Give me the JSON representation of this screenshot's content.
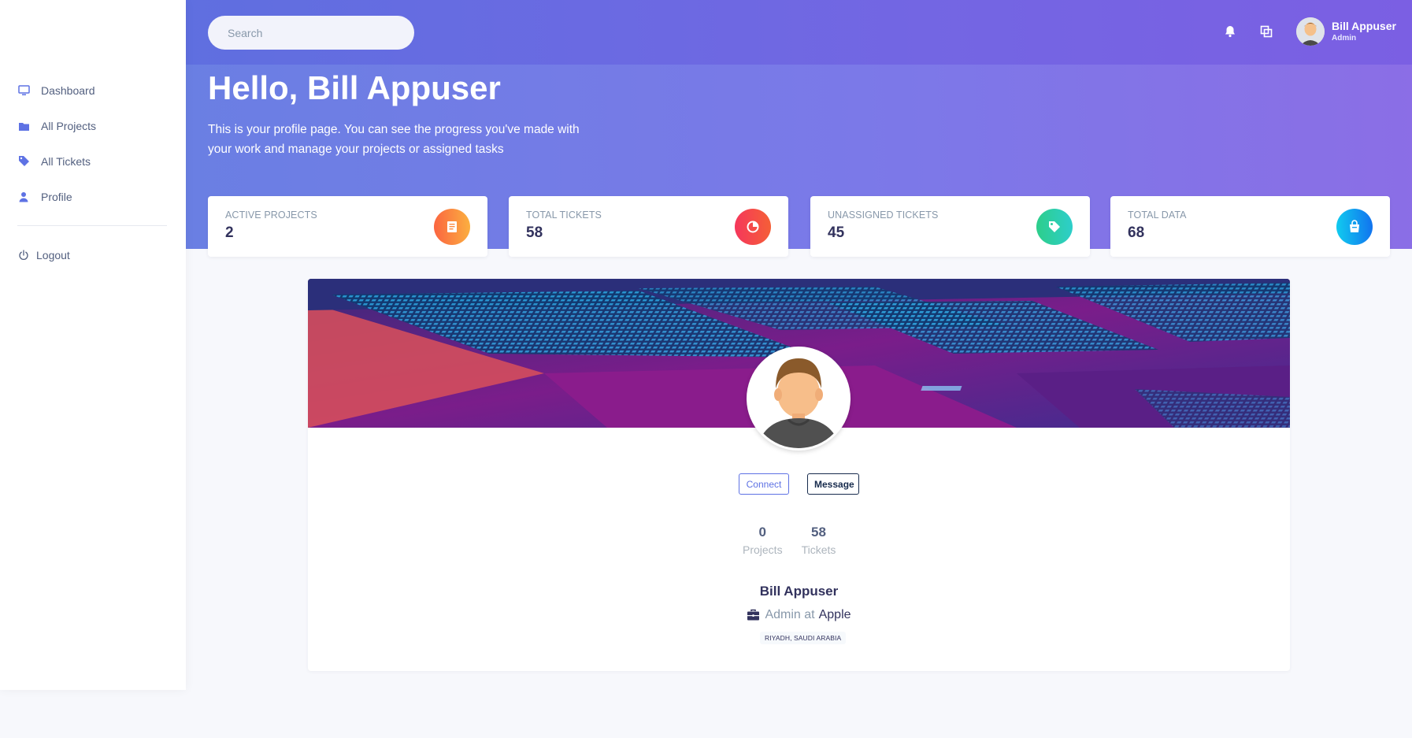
{
  "colors": {
    "accent": "#5e72e4",
    "gradient_start": "#6a7fe3",
    "gradient_end": "#8b6ee6",
    "sidebar_icon": "#5e72e4"
  },
  "sidebar": {
    "items": [
      {
        "label": "Dashboard",
        "icon": "monitor-icon"
      },
      {
        "label": "All Projects",
        "icon": "folder-icon"
      },
      {
        "label": "All Tickets",
        "icon": "tag-icon"
      },
      {
        "label": "Profile",
        "icon": "user-icon"
      }
    ],
    "logout": {
      "label": "Logout",
      "icon": "power-icon"
    }
  },
  "topbar": {
    "search_placeholder": "Search",
    "notification_icon": "bell-icon",
    "windows_icon": "copy-icon",
    "user": {
      "name": "Bill Appuser",
      "role": "Admin"
    }
  },
  "hero": {
    "greeting": "Hello, Bill Appuser",
    "description": "This is your profile page. You can see the progress you've made with your work and manage your projects or assigned tasks"
  },
  "stats": [
    {
      "label": "ACTIVE PROJECTS",
      "value": "2",
      "color": "#f5603c",
      "icon": "document-icon"
    },
    {
      "label": "TOTAL TICKETS",
      "value": "58",
      "color": "#f5365c",
      "icon": "pie-chart-icon"
    },
    {
      "label": "UNASSIGNED TICKETS",
      "value": "45",
      "color": "#2dce89",
      "icon": "tag-icon"
    },
    {
      "label": "TOTAL DATA",
      "value": "68",
      "color": "#11cdef",
      "icon": "bag-icon"
    }
  ],
  "profile": {
    "connect_label": "Connect",
    "message_label": "Message",
    "counts": [
      {
        "value": "0",
        "label": "Projects"
      },
      {
        "value": "58",
        "label": "Tickets"
      }
    ],
    "name": "Bill Appuser",
    "title_prefix": "Admin at",
    "company": "Apple",
    "location": "RIYADH, SAUDI ARABIA"
  }
}
